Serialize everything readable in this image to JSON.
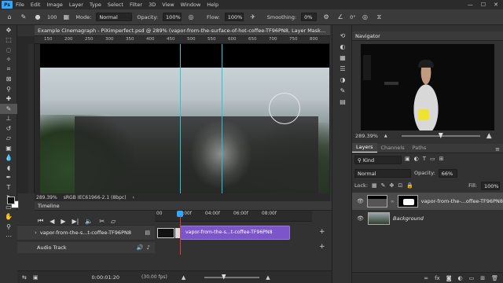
{
  "menubar": {
    "logo": "Ps",
    "items": [
      "File",
      "Edit",
      "Image",
      "Layer",
      "Type",
      "Select",
      "Filter",
      "3D",
      "View",
      "Window",
      "Help"
    ],
    "window_controls": [
      "—",
      "☐",
      "✕"
    ]
  },
  "options": {
    "mode_label": "Mode:",
    "mode_value": "Normal",
    "opacity_label": "Opacity:",
    "opacity_value": "100%",
    "flow_label": "Flow:",
    "flow_value": "100%",
    "smoothing_label": "Smoothing:",
    "smoothing_value": "0%",
    "brush_size": "100",
    "angle_value": "0°"
  },
  "document": {
    "tab_title": "Example Cinemagraph - PiXimperfect.psd @ 289% (vapor-from-the-surface-of-hot-coffee-TF96PN8, Layer Mask...",
    "ruler_labels": [
      "150",
      "200",
      "250",
      "300",
      "350",
      "400",
      "450",
      "500",
      "550",
      "600",
      "650",
      "700",
      "750",
      "800"
    ],
    "status_zoom": "289.39%",
    "status_profile": "sRGB IEC61966-2.1 (8bpc)"
  },
  "timeline": {
    "title": "Timeline",
    "ruler_labels": [
      "00",
      "02:00f",
      "04:00f",
      "06:00f",
      "08:00f"
    ],
    "video_layer_name": "vapor-from-the-s...t-coffee-TF96PN8",
    "clip_label": "vapor-from-the-s...t-coffee-TF96PN8",
    "audio_track_label": "Audio Track",
    "current_time": "0:00:01:20",
    "fps": "(30.00 fps)",
    "zoom_level": 0.35
  },
  "navigator": {
    "title": "Navigator",
    "zoom": "289.39%",
    "zoom_level": 0.5
  },
  "layers": {
    "tabs": [
      "Layers",
      "Channels",
      "Paths"
    ],
    "filter_kind": "Kind",
    "blend_mode": "Normal",
    "opacity_label": "Opacity:",
    "opacity_value": "66%",
    "lock_label": "Lock:",
    "fill_label": "Fill:",
    "fill_value": "100%",
    "items": [
      {
        "name": "vapor-from-the-...offee-TF96PN8",
        "selected": true
      },
      {
        "name": "Background",
        "selected": false
      }
    ]
  },
  "colors": {
    "accent": "#31a8ff",
    "guide": "#22c7d8",
    "clip": "#7b55c9",
    "playhead": "#e23b3b"
  }
}
